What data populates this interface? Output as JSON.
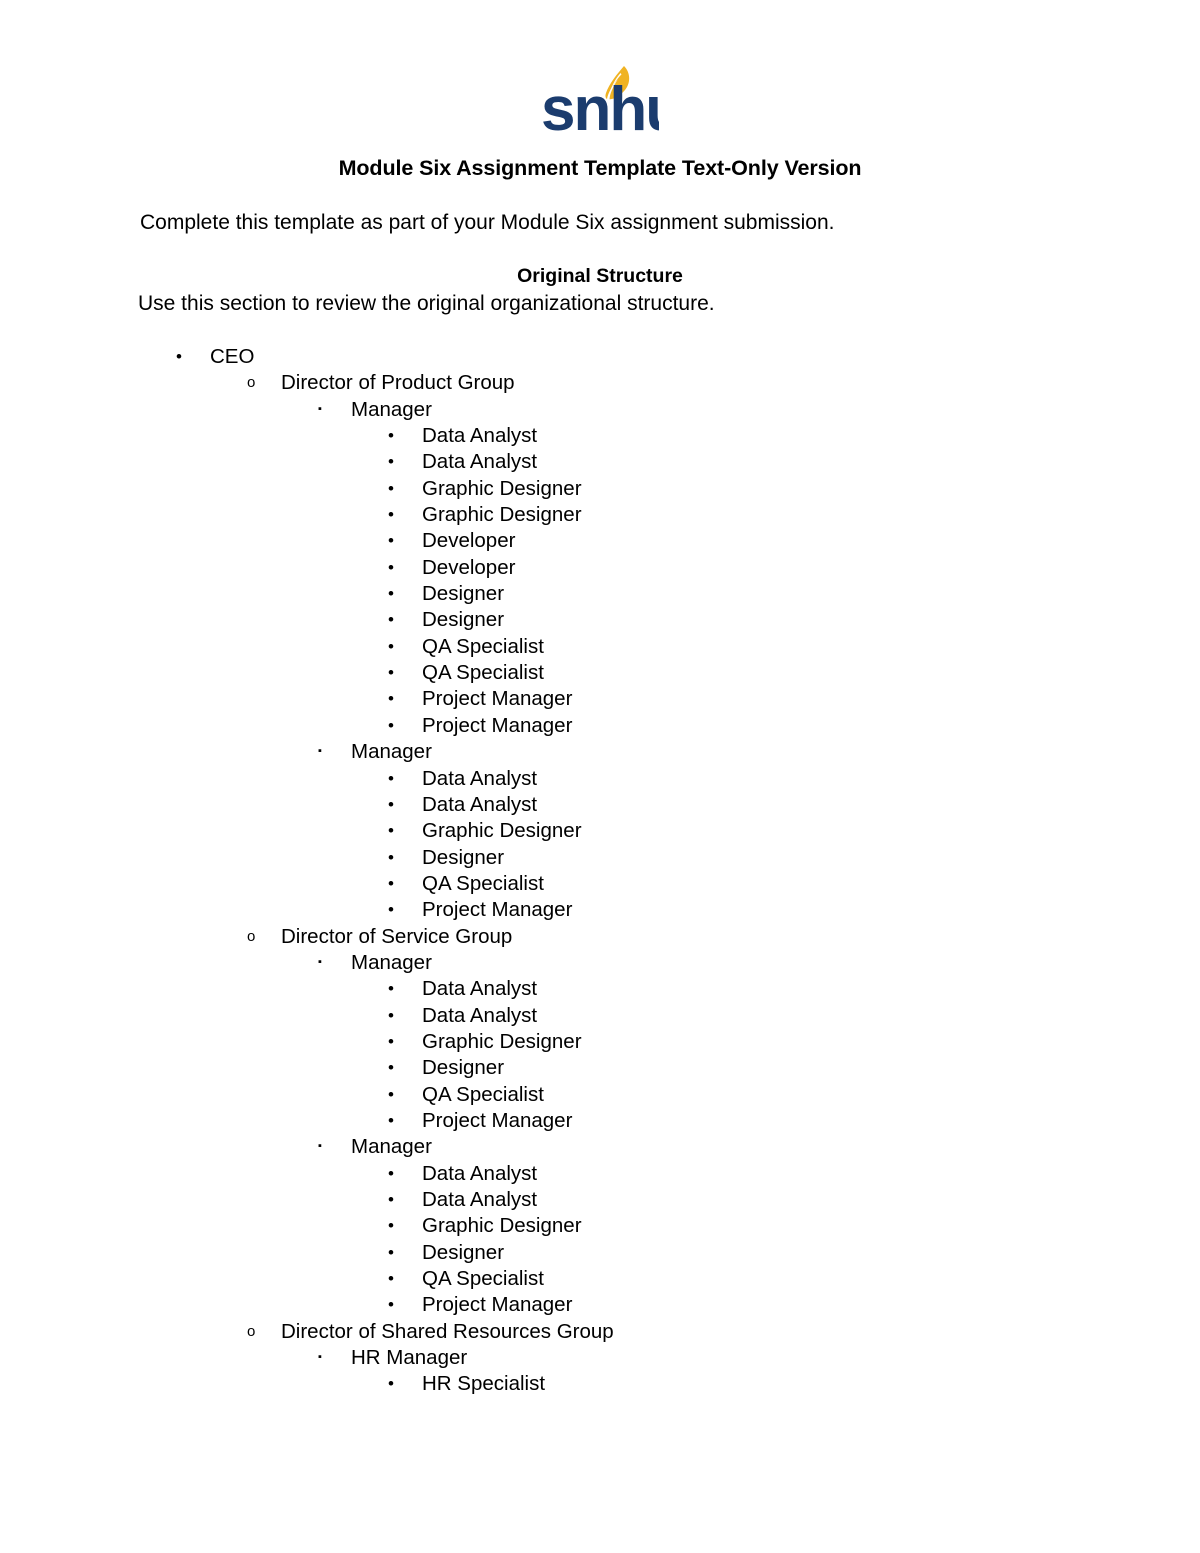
{
  "brand": {
    "logo_text": "snhu",
    "logo_name": "snhu-logo",
    "navy": "#1B3C6E",
    "gold": "#F0B323"
  },
  "document": {
    "title": "Module Six Assignment Template Text-Only Version",
    "intro": "Complete this template as part of your Module Six assignment submission.",
    "section_heading": "Original Structure",
    "section_subtext": "Use this section to review the original organizational structure."
  },
  "bullets": {
    "level1": "•",
    "level2": "o",
    "level3": "▪",
    "level4": "•"
  },
  "outline": [
    {
      "level": 1,
      "label": "CEO"
    },
    {
      "level": 2,
      "label": "Director of Product Group"
    },
    {
      "level": 3,
      "label": "Manager"
    },
    {
      "level": 4,
      "label": "Data Analyst"
    },
    {
      "level": 4,
      "label": "Data Analyst"
    },
    {
      "level": 4,
      "label": "Graphic Designer"
    },
    {
      "level": 4,
      "label": "Graphic Designer"
    },
    {
      "level": 4,
      "label": "Developer"
    },
    {
      "level": 4,
      "label": "Developer"
    },
    {
      "level": 4,
      "label": "Designer"
    },
    {
      "level": 4,
      "label": "Designer"
    },
    {
      "level": 4,
      "label": "QA Specialist"
    },
    {
      "level": 4,
      "label": "QA Specialist"
    },
    {
      "level": 4,
      "label": "Project Manager"
    },
    {
      "level": 4,
      "label": "Project Manager"
    },
    {
      "level": 3,
      "label": "Manager"
    },
    {
      "level": 4,
      "label": "Data Analyst"
    },
    {
      "level": 4,
      "label": "Data Analyst"
    },
    {
      "level": 4,
      "label": "Graphic Designer"
    },
    {
      "level": 4,
      "label": "Designer"
    },
    {
      "level": 4,
      "label": "QA Specialist"
    },
    {
      "level": 4,
      "label": "Project Manager"
    },
    {
      "level": 2,
      "label": "Director of Service Group"
    },
    {
      "level": 3,
      "label": "Manager"
    },
    {
      "level": 4,
      "label": "Data Analyst"
    },
    {
      "level": 4,
      "label": "Data Analyst"
    },
    {
      "level": 4,
      "label": "Graphic Designer"
    },
    {
      "level": 4,
      "label": "Designer"
    },
    {
      "level": 4,
      "label": "QA Specialist"
    },
    {
      "level": 4,
      "label": "Project Manager"
    },
    {
      "level": 3,
      "label": "Manager"
    },
    {
      "level": 4,
      "label": "Data Analyst"
    },
    {
      "level": 4,
      "label": "Data Analyst"
    },
    {
      "level": 4,
      "label": "Graphic Designer"
    },
    {
      "level": 4,
      "label": "Designer"
    },
    {
      "level": 4,
      "label": "QA Specialist"
    },
    {
      "level": 4,
      "label": "Project Manager"
    },
    {
      "level": 2,
      "label": "Director of Shared Resources Group"
    },
    {
      "level": 3,
      "label": "HR Manager"
    },
    {
      "level": 4,
      "label": "HR Specialist"
    }
  ]
}
